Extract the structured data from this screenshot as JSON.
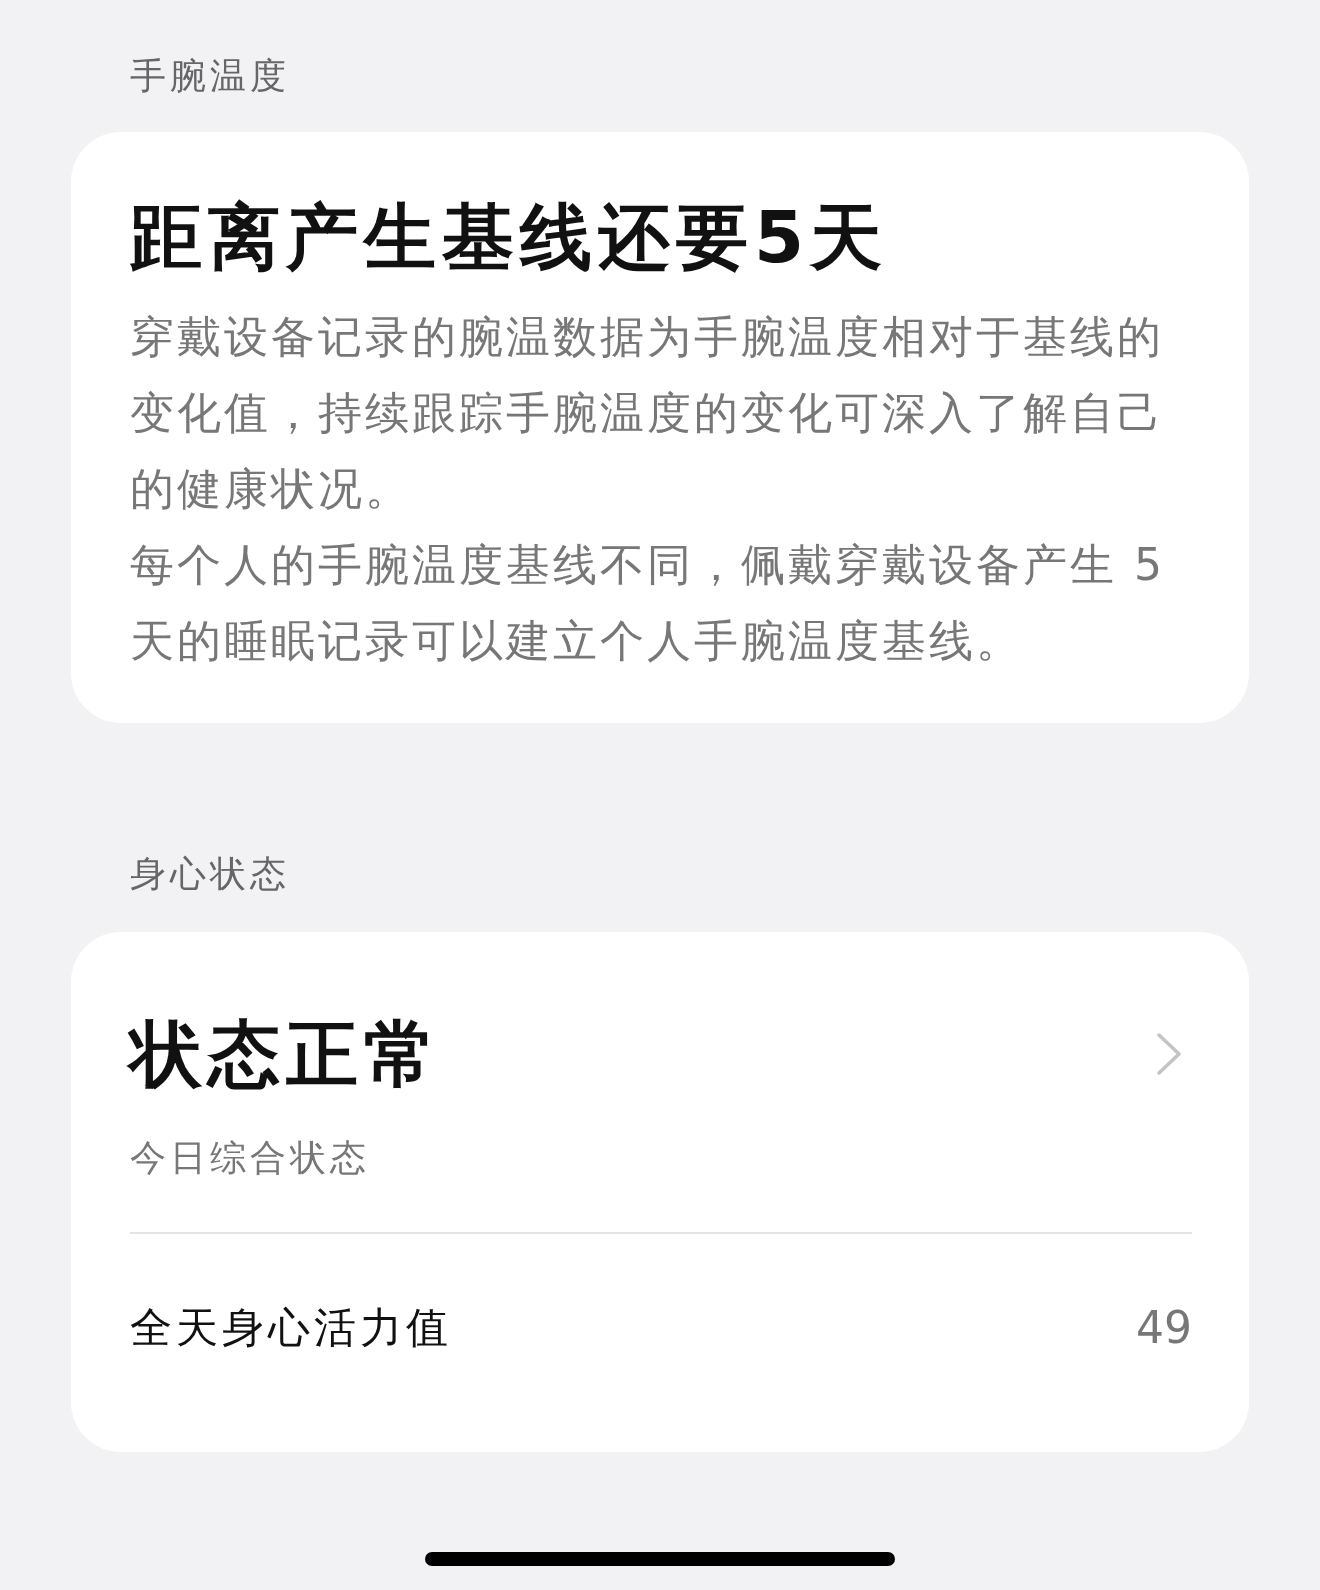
{
  "sections": [
    {
      "label": "手腕温度",
      "card": {
        "kind": "info",
        "title": "距离产生基线还要5天",
        "paragraphs": [
          "穿戴设备记录的腕温数据为手腕温度相对于基线的变化值，持续跟踪手腕温度的变化可深入了解自己的健康状况。",
          "每个人的手腕温度基线不同，佩戴穿戴设备产生 5 天的睡眠记录可以建立个人手腕温度基线。"
        ]
      }
    },
    {
      "label": "身心状态",
      "card": {
        "kind": "status",
        "title": "状态正常",
        "subtitle": "今日综合状态",
        "rows": [
          {
            "label": "全天身心活力值",
            "value": "49"
          }
        ]
      }
    }
  ]
}
